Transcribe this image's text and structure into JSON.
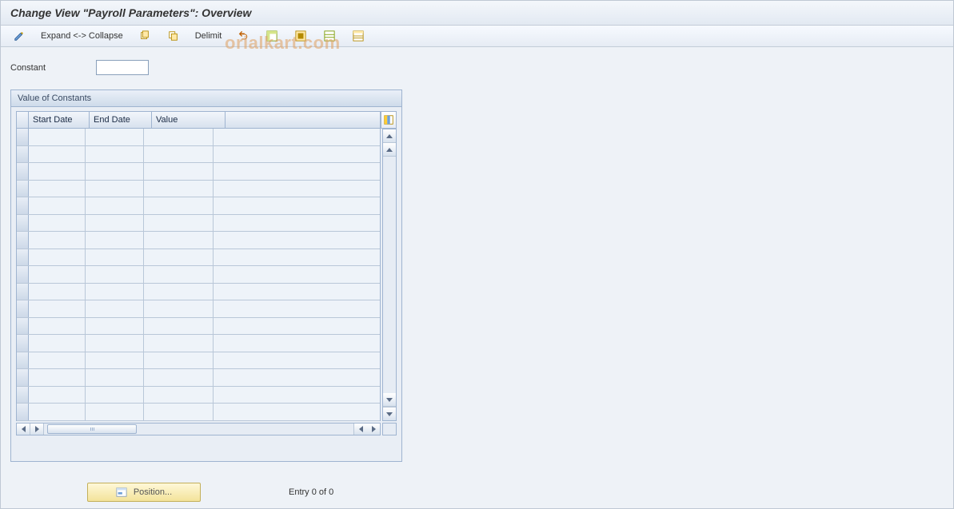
{
  "title": "Change View \"Payroll Parameters\": Overview",
  "toolbar": {
    "expand_collapse_label": "Expand <-> Collapse",
    "delimit_label": "Delimit"
  },
  "field": {
    "constant_label": "Constant",
    "constant_value": ""
  },
  "group": {
    "title": "Value of Constants",
    "columns": {
      "start_date": "Start Date",
      "end_date": "End Date",
      "value": "Value"
    },
    "rows": [
      {
        "start_date": "",
        "end_date": "",
        "value": ""
      },
      {
        "start_date": "",
        "end_date": "",
        "value": ""
      },
      {
        "start_date": "",
        "end_date": "",
        "value": ""
      },
      {
        "start_date": "",
        "end_date": "",
        "value": ""
      },
      {
        "start_date": "",
        "end_date": "",
        "value": ""
      },
      {
        "start_date": "",
        "end_date": "",
        "value": ""
      },
      {
        "start_date": "",
        "end_date": "",
        "value": ""
      },
      {
        "start_date": "",
        "end_date": "",
        "value": ""
      },
      {
        "start_date": "",
        "end_date": "",
        "value": ""
      },
      {
        "start_date": "",
        "end_date": "",
        "value": ""
      },
      {
        "start_date": "",
        "end_date": "",
        "value": ""
      },
      {
        "start_date": "",
        "end_date": "",
        "value": ""
      },
      {
        "start_date": "",
        "end_date": "",
        "value": ""
      },
      {
        "start_date": "",
        "end_date": "",
        "value": ""
      },
      {
        "start_date": "",
        "end_date": "",
        "value": ""
      },
      {
        "start_date": "",
        "end_date": "",
        "value": ""
      },
      {
        "start_date": "",
        "end_date": "",
        "value": ""
      }
    ]
  },
  "footer": {
    "position_label": "Position...",
    "entry_text": "Entry 0 of 0"
  },
  "watermark": "orialkart.com"
}
